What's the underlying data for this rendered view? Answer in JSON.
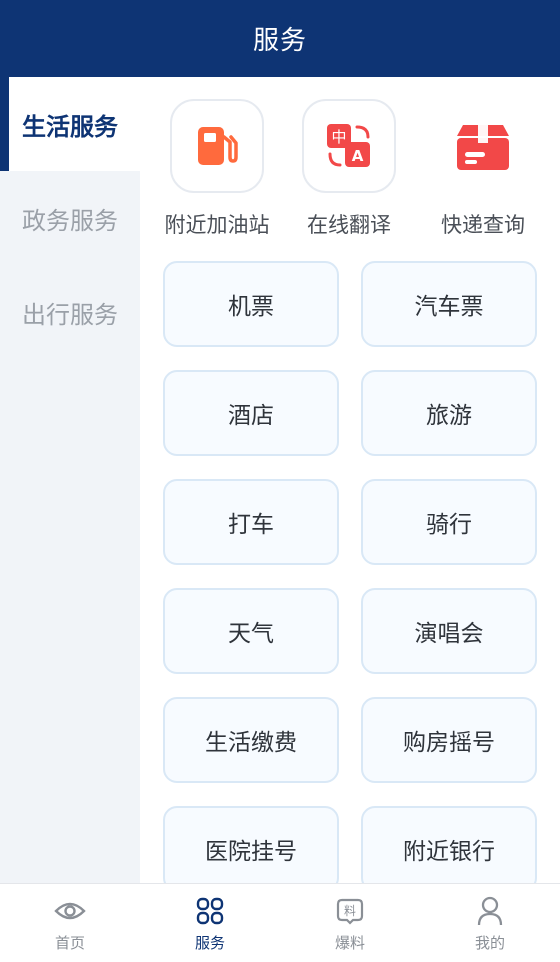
{
  "header": {
    "title": "服务"
  },
  "sidebar": {
    "items": [
      {
        "label": "生活服务",
        "active": true
      },
      {
        "label": "政务服务",
        "active": false
      },
      {
        "label": "出行服务",
        "active": false
      }
    ]
  },
  "quick_services": [
    {
      "label": "附近加油站",
      "icon": "gas-station-icon"
    },
    {
      "label": "在线翻译",
      "icon": "translate-icon"
    },
    {
      "label": "快递查询",
      "icon": "package-icon"
    }
  ],
  "services": [
    "机票",
    "汽车票",
    "酒店",
    "旅游",
    "打车",
    "骑行",
    "天气",
    "演唱会",
    "生活缴费",
    "购房摇号",
    "医院挂号",
    "附近银行"
  ],
  "tabbar": {
    "items": [
      {
        "label": "首页",
        "icon": "eye-icon",
        "active": false
      },
      {
        "label": "服务",
        "icon": "grid-icon",
        "active": true
      },
      {
        "label": "爆料",
        "icon": "tip-off-icon",
        "icon_text": "料",
        "active": false
      },
      {
        "label": "我的",
        "icon": "person-icon",
        "active": false
      }
    ]
  },
  "colors": {
    "primary": "#0e3474",
    "accent_orange": "#ff6a3d",
    "accent_red": "#f24848",
    "tile_border": "#d9e8f6",
    "sidebar_bg": "#f1f4f8"
  }
}
